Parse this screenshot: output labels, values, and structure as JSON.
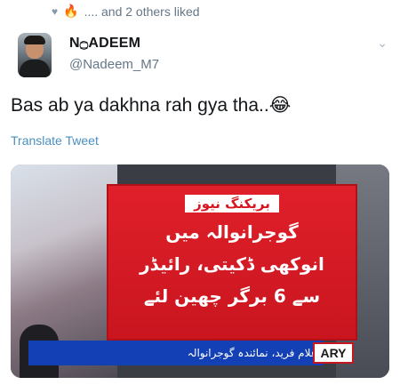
{
  "social_context": {
    "heart_icon": "heart-icon",
    "fire_emoji": "🔥",
    "text": ".... and 2 others liked"
  },
  "tweet": {
    "display_name": "N۝ADEEM",
    "handle": "@Nadeem_M7",
    "text": "Bas ab ya dakhna rah gya tha..😂",
    "translate_label": "Translate Tweet"
  },
  "media": {
    "breaking_label": "بریکنگ نیوز",
    "headline_lines": [
      "گوجرانوالہ میں",
      "انوکھی ڈکیتی، رائیڈر",
      "سے 6 برگر چھین لئے"
    ],
    "ticker_text": "غلام فرید، نمائندہ گوجرانوالہ",
    "logo_text": "ARY",
    "accent_red": "#d8141f",
    "ticker_blue": "#1340b5"
  }
}
